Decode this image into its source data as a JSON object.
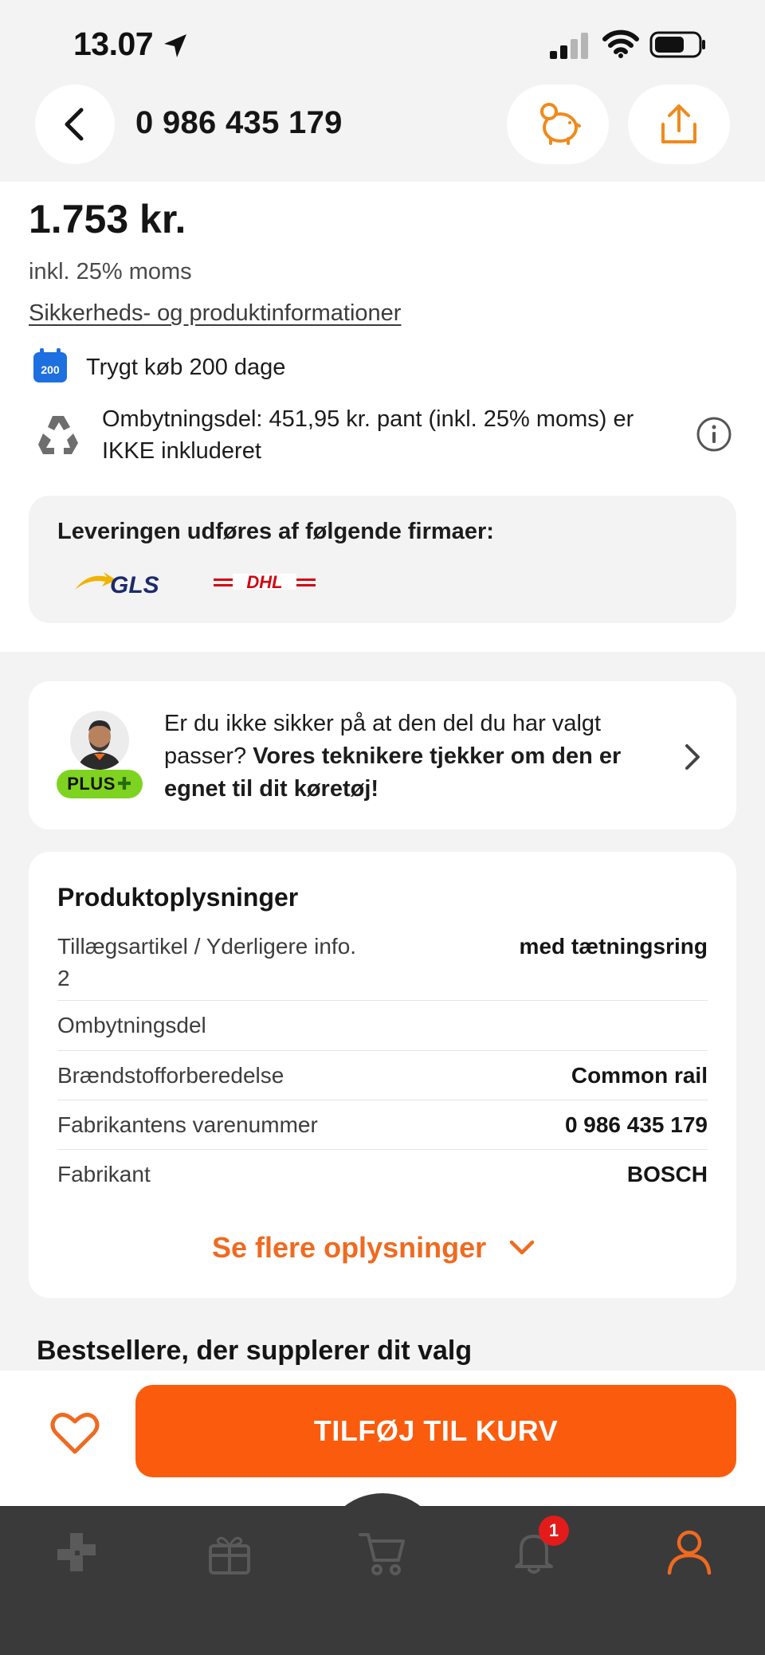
{
  "status_bar": {
    "time": "13.07"
  },
  "header": {
    "title": "0 986 435 179"
  },
  "product": {
    "price": "1.753 kr.",
    "vat_note": "inkl. 25% moms",
    "safety_link": "Sikkerheds- og produktinformationer",
    "calendar_badge": "200",
    "safe_purchase": "Trygt køb 200 dage",
    "exchange_note": "Ombytningsdel: 451,95 kr. pant (inkl. 25% moms) er IKKE inkluderet"
  },
  "delivery": {
    "title": "Leveringen udføres af følgende firmaer:",
    "carriers": [
      "GLS",
      "DHL"
    ]
  },
  "plus_card": {
    "badge": "PLUS",
    "text_regular": "Er du ikke sikker på at den del du har valgt passer? ",
    "text_bold": "Vores teknikere tjekker om den er egnet  til dit køretøj!"
  },
  "product_info": {
    "title": "Produktoplysninger",
    "rows": [
      {
        "label": "Tillægsartikel / Yderligere info. 2",
        "value": "med tætningsring"
      },
      {
        "label": "Ombytningsdel",
        "value": ""
      },
      {
        "label": "Brændstofforberedelse",
        "value": "Common rail"
      },
      {
        "label": "Fabrikantens varenummer",
        "value": "0 986 435 179"
      },
      {
        "label": "Fabrikant",
        "value": "BOSCH"
      }
    ],
    "more_label": "Se flere oplysninger"
  },
  "bestsellers_title": "Bestsellere, der supplerer dit valg",
  "cta": {
    "add_to_cart": "TILFØJ TIL KURV"
  },
  "tab_bar": {
    "items": [
      "catalog-icon",
      "gift-icon",
      "cart-icon",
      "bell-icon",
      "profile-icon"
    ],
    "notification_count": "1"
  },
  "colors": {
    "accent": "#fb5b0c",
    "accent_text": "#ef6a20",
    "plus_green": "#7ed321",
    "tab_bg": "#3a3a3a"
  }
}
